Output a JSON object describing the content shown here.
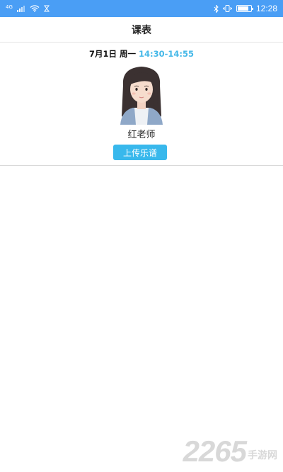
{
  "status_bar": {
    "network": "4G",
    "time": "12:28",
    "battery_level": 0.85,
    "icons": [
      "signal-icon",
      "wifi-icon",
      "download-icon",
      "bluetooth-icon",
      "vibrate-icon",
      "battery-icon"
    ]
  },
  "nav": {
    "title": "课表"
  },
  "lesson": {
    "date": "7月1日 周一",
    "time_range": "14:30-14:55",
    "teacher_name": "红老师",
    "upload_label": "上传乐谱"
  },
  "watermark": {
    "number": "2265",
    "text": "手游网"
  },
  "colors": {
    "status_bar": "#4a9ef5",
    "accent": "#45b8e8",
    "button": "#38b8ec"
  }
}
